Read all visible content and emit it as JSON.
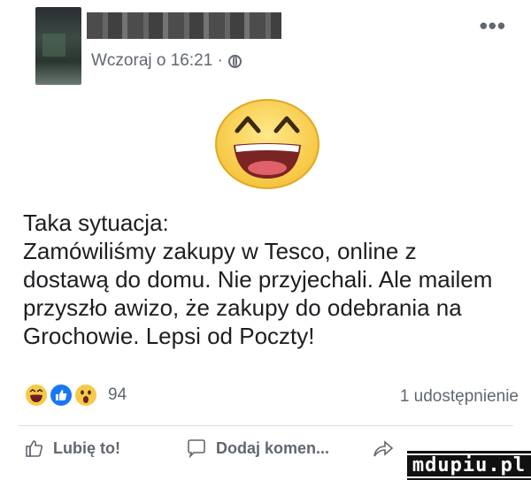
{
  "post": {
    "timestamp": "Wczoraj o 16:21 ·",
    "privacy_icon": "globe-icon",
    "more_icon": "•••",
    "big_emoji": "grinning-face-emoji",
    "text": "Taka sytuacja:\nZamówiliśmy zakupy w Tesco, online z\ndostawą do domu. Nie przyjechali. Ale mailem\nprzyszło awizo, że zakupy do odebrania na\nGrochowie. Lepsi od Poczty!"
  },
  "reactions": {
    "icons": [
      "haha-reaction-icon",
      "like-reaction-icon",
      "wow-reaction-icon"
    ],
    "count": "94",
    "shares": "1 udostępnienie"
  },
  "actions": {
    "like_label": "Lubię to!",
    "comment_label": "Dodaj komen...",
    "share_icon": "share-arrow-icon"
  },
  "watermark": {
    "text": "mdupiu.pl"
  },
  "colors": {
    "meta_gray": "#616770",
    "facebook_blue": "#1877f2",
    "emoji_yellow": "#f7c948"
  }
}
